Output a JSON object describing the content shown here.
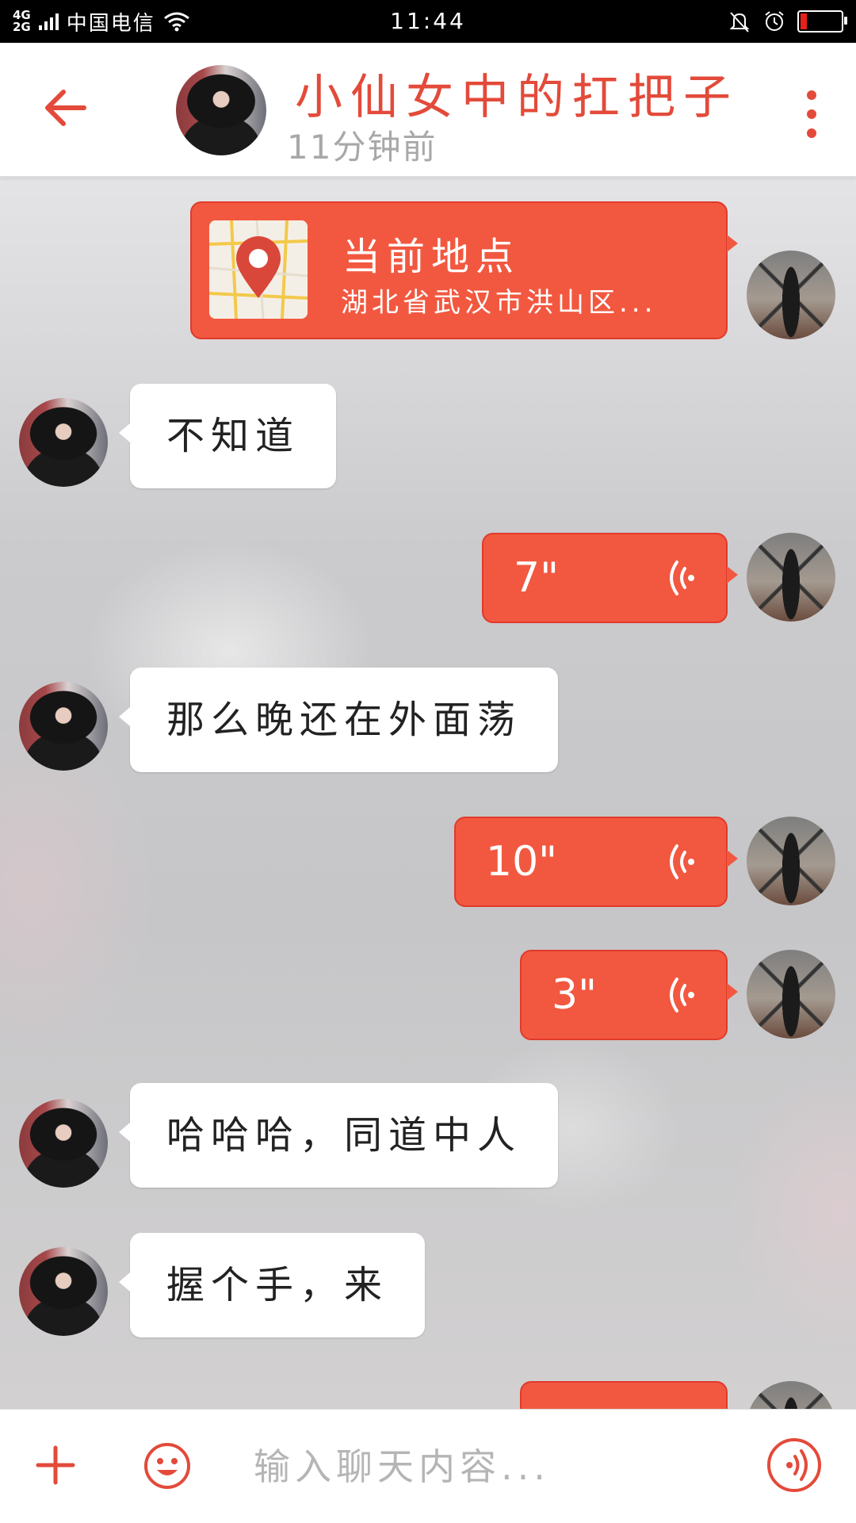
{
  "status_bar": {
    "network": "4G\n2G",
    "carrier": "中国电信",
    "time": "11:44"
  },
  "header": {
    "contact_name": "小仙女中的扛把子",
    "last_seen": "11分钟前"
  },
  "messages": [
    {
      "side": "right",
      "type": "location",
      "title": "当前地点",
      "address": "湖北省武汉市洪山区..."
    },
    {
      "side": "left",
      "type": "text",
      "text": "不知道"
    },
    {
      "side": "right",
      "type": "voice",
      "duration": "7\""
    },
    {
      "side": "left",
      "type": "text",
      "text": "那么晚还在外面荡"
    },
    {
      "side": "right",
      "type": "voice",
      "duration": "10\""
    },
    {
      "side": "right",
      "type": "voice",
      "duration": "3\""
    },
    {
      "side": "left",
      "type": "text",
      "text": "哈哈哈，同道中人"
    },
    {
      "side": "left",
      "type": "text",
      "text": "握个手，来"
    },
    {
      "side": "right",
      "type": "voice",
      "duration": ""
    }
  ],
  "input_bar": {
    "placeholder": "输入聊天内容..."
  },
  "icons": {
    "back": "arrow-left-icon",
    "more": "more-vertical-icon",
    "plus": "plus-icon",
    "emoji": "smiley-icon",
    "voice": "voice-wave-icon",
    "location": "map-pin-icon"
  },
  "colors": {
    "accent": "#e34a3a",
    "bubble_sent": "#f25840",
    "bubble_received": "#ffffff"
  }
}
